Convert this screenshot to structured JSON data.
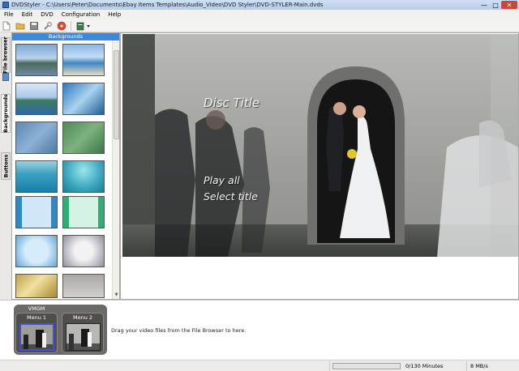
{
  "window": {
    "title": "DVDStyler - C:\\Users\\Peter\\Documents\\Ebay Items Templates\\Audio_Video\\DVD Styler\\DVD-STYLER-Main.dvds",
    "controls": {
      "minimize": "—",
      "maximize": "□",
      "close": "✕"
    }
  },
  "menubar": {
    "items": [
      "File",
      "Edit",
      "DVD",
      "Configuration",
      "Help"
    ]
  },
  "toolbar": {
    "icons": [
      "new-file-icon",
      "open-folder-icon",
      "save-icon",
      "settings-wrench-icon",
      "burn-disc-icon",
      "add-menu-icon",
      "dropdown-arrow-icon"
    ]
  },
  "side_tabs": {
    "file_browser": "File browser",
    "backgrounds": "Backgrounds",
    "buttons": "Buttons"
  },
  "backgrounds_panel": {
    "header": "Backgrounds",
    "thumbnails": [
      "coastal-landscape",
      "sea-shore",
      "coastal-island",
      "blue-gradient",
      "blue-texture",
      "green-texture",
      "teal-stripes",
      "teal-rays",
      "blue-frame",
      "green-frame",
      "blue-soft-frame",
      "grey-frame",
      "gold-gradient",
      "grey-gradient"
    ]
  },
  "preview": {
    "disc_title": "Disc Title",
    "buttons": [
      "Play all",
      "Select title"
    ]
  },
  "titleset": {
    "vmgm_label": "VMGM",
    "menus": [
      {
        "label": "Menu 1",
        "selected": true
      },
      {
        "label": "Menu 2",
        "selected": false
      }
    ],
    "drag_hint": "Drag your video files from the File Browser to here."
  },
  "status": {
    "progress_fraction": 0,
    "minutes": "0/130 Minutes",
    "rate": "8 MB/s"
  },
  "colors": {
    "header_blue": "#3c8ae0",
    "selected_menu_border": "#4750c8",
    "close_red": "#c8473a"
  }
}
